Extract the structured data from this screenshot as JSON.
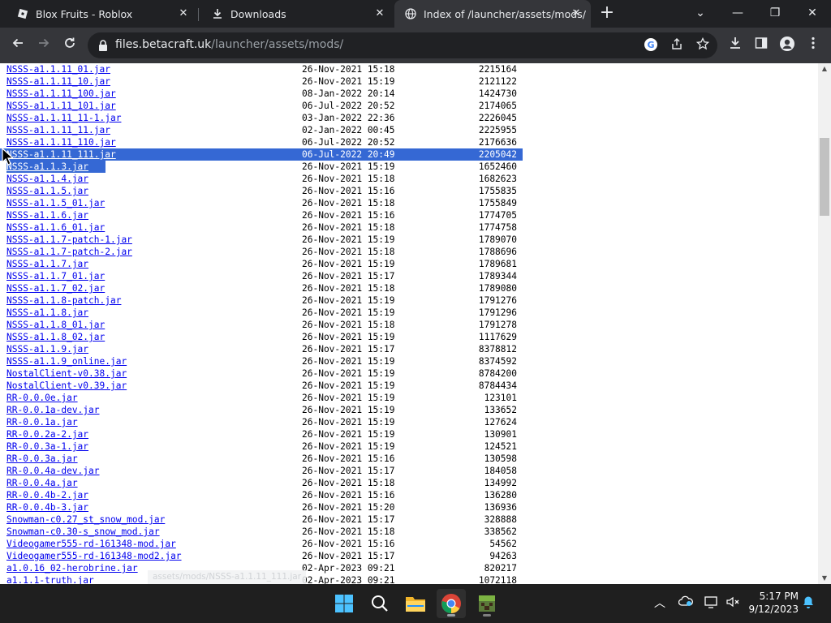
{
  "browser": {
    "tabs": [
      {
        "title": "Blox Fruits - Roblox",
        "icon": "roblox-icon",
        "close": "✕"
      },
      {
        "title": "Downloads",
        "icon": "download-icon",
        "close": "✕"
      },
      {
        "title": "Index of /launcher/assets/mods/",
        "icon": "globe-icon",
        "close": "✕",
        "active": true
      }
    ],
    "new_tab": "+",
    "window_controls": {
      "tab_search": "⌄",
      "minimize": "—",
      "restore": "❐",
      "close": "✕"
    },
    "url_host": "files.betacraft.uk",
    "url_path": "/launcher/assets/mods/"
  },
  "listing": {
    "selected_index": 7,
    "partial_index": 8,
    "rows": [
      {
        "name": "NSSS-a1.1.11_01.jar",
        "date": "26-Nov-2021 15:18",
        "size": "2215164"
      },
      {
        "name": "NSSS-a1.1.11_10.jar",
        "date": "26-Nov-2021 15:19",
        "size": "2121122"
      },
      {
        "name": "NSSS-a1.1.11_100.jar",
        "date": "08-Jan-2022 20:14",
        "size": "1424730"
      },
      {
        "name": "NSSS-a1.1.11_101.jar",
        "date": "06-Jul-2022 20:52",
        "size": "2174065"
      },
      {
        "name": "NSSS-a1.1.11_11-1.jar",
        "date": "03-Jan-2022 22:36",
        "size": "2226045"
      },
      {
        "name": "NSSS-a1.1.11_11.jar",
        "date": "02-Jan-2022 00:45",
        "size": "2225955"
      },
      {
        "name": "NSSS-a1.1.11_110.jar",
        "date": "06-Jul-2022 20:52",
        "size": "2176636"
      },
      {
        "name": "NSSS-a1.1.11_111.jar",
        "date": "06-Jul-2022 20:49",
        "size": "2205042"
      },
      {
        "name": "NSSS-a1.1.3.jar",
        "date": "26-Nov-2021 15:19",
        "size": "1652460"
      },
      {
        "name": "NSSS-a1.1.4.jar",
        "date": "26-Nov-2021 15:18",
        "size": "1682623"
      },
      {
        "name": "NSSS-a1.1.5.jar",
        "date": "26-Nov-2021 15:16",
        "size": "1755835"
      },
      {
        "name": "NSSS-a1.1.5_01.jar",
        "date": "26-Nov-2021 15:18",
        "size": "1755849"
      },
      {
        "name": "NSSS-a1.1.6.jar",
        "date": "26-Nov-2021 15:16",
        "size": "1774705"
      },
      {
        "name": "NSSS-a1.1.6_01.jar",
        "date": "26-Nov-2021 15:18",
        "size": "1774758"
      },
      {
        "name": "NSSS-a1.1.7-patch-1.jar",
        "date": "26-Nov-2021 15:19",
        "size": "1789070"
      },
      {
        "name": "NSSS-a1.1.7-patch-2.jar",
        "date": "26-Nov-2021 15:18",
        "size": "1788696"
      },
      {
        "name": "NSSS-a1.1.7.jar",
        "date": "26-Nov-2021 15:19",
        "size": "1789681"
      },
      {
        "name": "NSSS-a1.1.7_01.jar",
        "date": "26-Nov-2021 15:17",
        "size": "1789344"
      },
      {
        "name": "NSSS-a1.1.7_02.jar",
        "date": "26-Nov-2021 15:18",
        "size": "1789080"
      },
      {
        "name": "NSSS-a1.1.8-patch.jar",
        "date": "26-Nov-2021 15:19",
        "size": "1791276"
      },
      {
        "name": "NSSS-a1.1.8.jar",
        "date": "26-Nov-2021 15:19",
        "size": "1791296"
      },
      {
        "name": "NSSS-a1.1.8_01.jar",
        "date": "26-Nov-2021 15:18",
        "size": "1791278"
      },
      {
        "name": "NSSS-a1.1.8_02.jar",
        "date": "26-Nov-2021 15:19",
        "size": "1117629"
      },
      {
        "name": "NSSS-a1.1.9.jar",
        "date": "26-Nov-2021 15:17",
        "size": "8378812"
      },
      {
        "name": "NSSS-a1.1.9_online.jar",
        "date": "26-Nov-2021 15:19",
        "size": "8374592"
      },
      {
        "name": "NostalClient-v0.38.jar",
        "date": "26-Nov-2021 15:19",
        "size": "8784200"
      },
      {
        "name": "NostalClient-v0.39.jar",
        "date": "26-Nov-2021 15:19",
        "size": "8784434"
      },
      {
        "name": "RR-0.0.0e.jar",
        "date": "26-Nov-2021 15:19",
        "size": "123101"
      },
      {
        "name": "RR-0.0.1a-dev.jar",
        "date": "26-Nov-2021 15:19",
        "size": "133652"
      },
      {
        "name": "RR-0.0.1a.jar",
        "date": "26-Nov-2021 15:19",
        "size": "127624"
      },
      {
        "name": "RR-0.0.2a-2.jar",
        "date": "26-Nov-2021 15:19",
        "size": "130901"
      },
      {
        "name": "RR-0.0.3a-1.jar",
        "date": "26-Nov-2021 15:19",
        "size": "124521"
      },
      {
        "name": "RR-0.0.3a.jar",
        "date": "26-Nov-2021 15:16",
        "size": "130598"
      },
      {
        "name": "RR-0.0.4a-dev.jar",
        "date": "26-Nov-2021 15:17",
        "size": "184058"
      },
      {
        "name": "RR-0.0.4a.jar",
        "date": "26-Nov-2021 15:18",
        "size": "134992"
      },
      {
        "name": "RR-0.0.4b-2.jar",
        "date": "26-Nov-2021 15:16",
        "size": "136280"
      },
      {
        "name": "RR-0.0.4b-3.jar",
        "date": "26-Nov-2021 15:20",
        "size": "136936"
      },
      {
        "name": "Snowman-c0.27_st_snow_mod.jar",
        "date": "26-Nov-2021 15:17",
        "size": "328888"
      },
      {
        "name": "Snowman-c0.30-s_snow_mod.jar",
        "date": "26-Nov-2021 15:18",
        "size": "338562"
      },
      {
        "name": "Videogamer555-rd-161348-mod.jar",
        "date": "26-Nov-2021 15:16",
        "size": "54562"
      },
      {
        "name": "Videogamer555-rd-161348-mod2.jar",
        "date": "26-Nov-2021 15:17",
        "size": "94263"
      },
      {
        "name": "a1.0.16_02-herobrine.jar",
        "date": "02-Apr-2023 09:21",
        "size": "820217"
      },
      {
        "name": "a1.1.1-truth.jar",
        "date": "02-Apr-2023 09:21",
        "size": "1072118"
      }
    ]
  },
  "status_url": "assets/mods/NSSS-a1.1.11_111.jar",
  "scrollbar": {
    "up": "▲",
    "down": "▼",
    "position": 0.15
  },
  "taskbar": {
    "apps": [
      "windows-start-icon",
      "search-icon",
      "file-explorer-icon",
      "chrome-icon",
      "minecraft-icon"
    ],
    "tray": {
      "chevron": "︿"
    },
    "time": "5:17 PM",
    "date": "9/12/2023"
  },
  "colors": {
    "link": "#0000ee",
    "selection": "#3568d4",
    "tab_bg": "#202124",
    "toolbar_bg": "#35363a"
  }
}
